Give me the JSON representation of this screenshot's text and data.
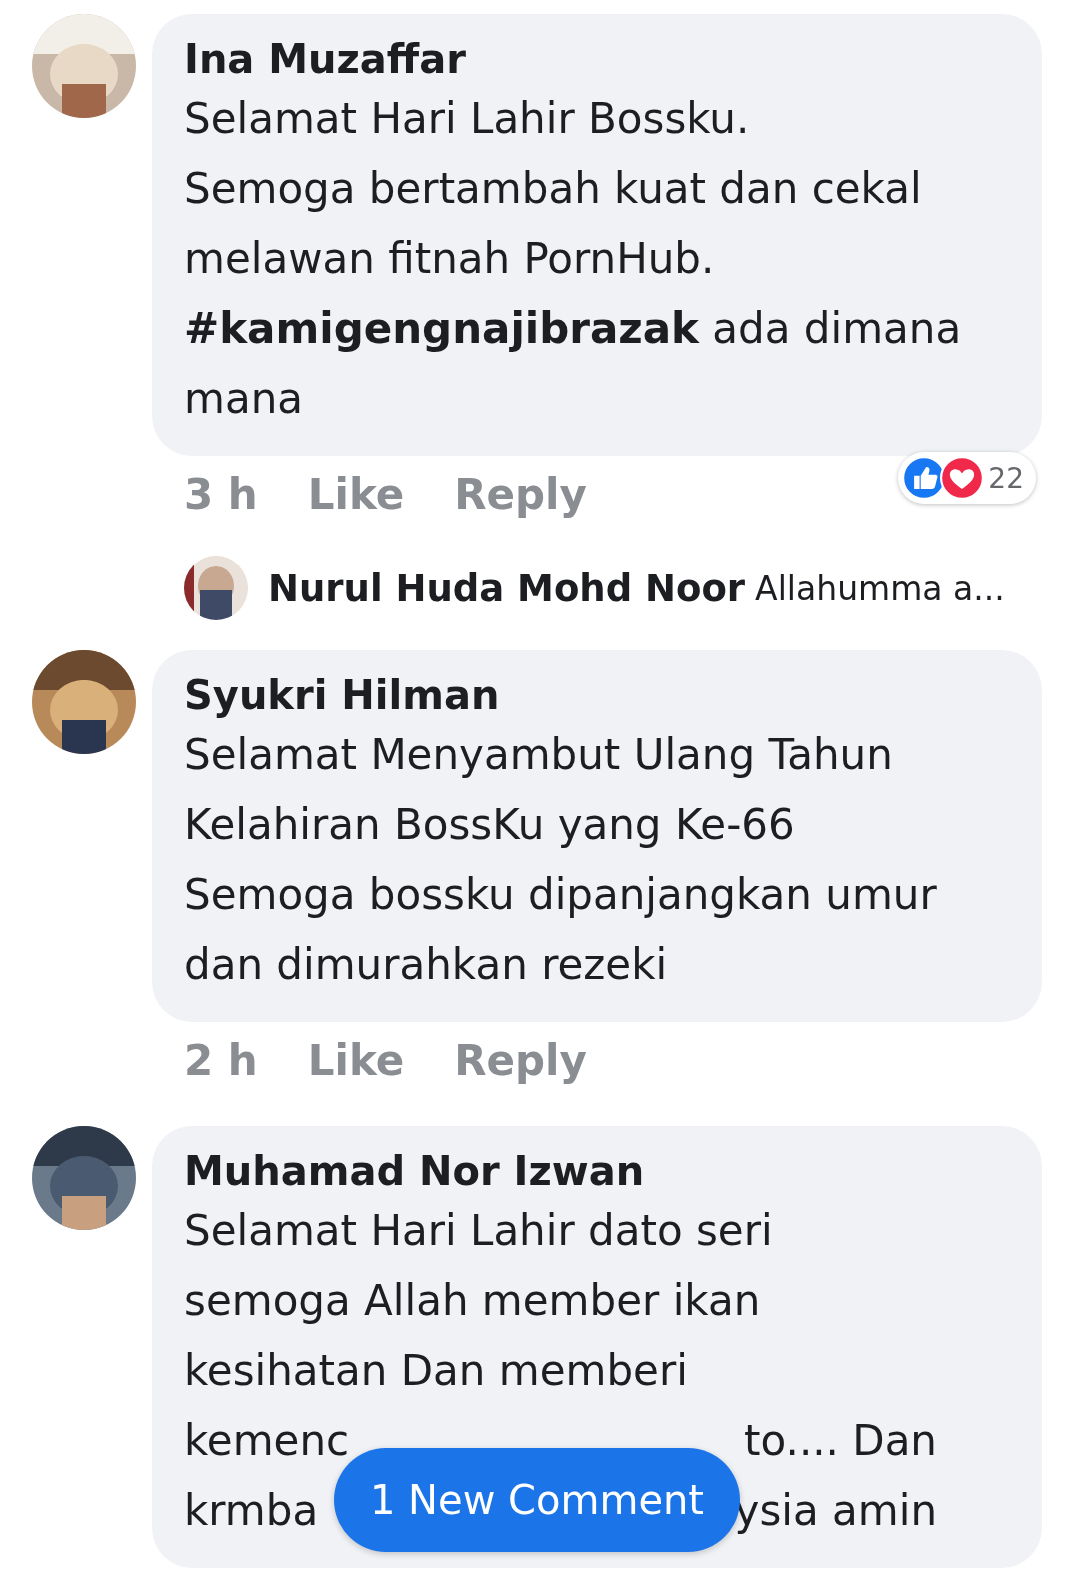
{
  "comments": [
    {
      "author": "Ina Muzaffar",
      "avatar": {
        "kind": "picture"
      },
      "lines": [
        "Selamat Hari Lahir Bossku.",
        "Semoga bertambah kuat dan cekal",
        "melawan fitnah PornHub.",
        "**#kamigengnajibrazak** ada dimana",
        "mana"
      ],
      "time": "3 h",
      "like": "Like",
      "reply": "Reply",
      "reactions": {
        "count": "22"
      },
      "reply_preview": {
        "author": "Nurul Huda Mohd Noor",
        "text": "Allahumma a..."
      }
    },
    {
      "author": "Syukri Hilman",
      "avatar": {
        "kind": "picture"
      },
      "lines": [
        "Selamat Menyambut Ulang Tahun",
        "Kelahiran BossKu yang Ke-66",
        "Semoga bossku dipanjangkan umur",
        "dan dimurahkan rezeki"
      ],
      "time": "2 h",
      "like": "Like",
      "reply": "Reply"
    },
    {
      "author": "Muhamad Nor Izwan",
      "avatar": {
        "kind": "picture"
      },
      "lines": [
        "Selamat Hari Lahir dato seri",
        "semoga Allah member ikan",
        "kesihatan Dan memberi",
        [
          "kemenc",
          "to.... Dan"
        ],
        [
          "krmba",
          "ysia amin"
        ]
      ]
    }
  ],
  "new_comment_button": "1 New Comment"
}
